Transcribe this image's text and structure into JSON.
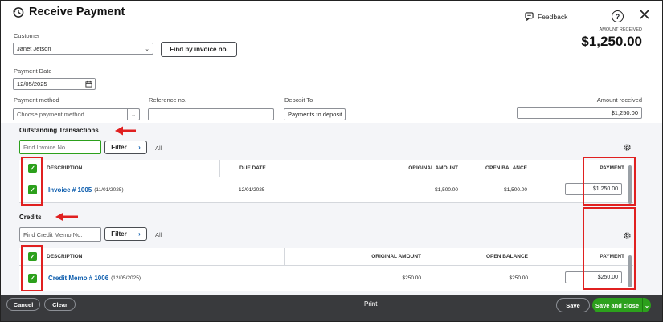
{
  "header": {
    "title": "Receive Payment",
    "feedback": "Feedback",
    "amount_received_label": "AMOUNT RECEIVED",
    "amount_received_value": "$1,250.00"
  },
  "form": {
    "customer_label": "Customer",
    "customer_value": "Janet Jetson",
    "find_invoice_button": "Find by invoice no.",
    "payment_date_label": "Payment Date",
    "payment_date_value": "12/05/2025",
    "payment_method_label": "Payment method",
    "payment_method_placeholder": "Choose payment method",
    "reference_label": "Reference no.",
    "deposit_to_label": "Deposit To",
    "deposit_to_value": "Payments to deposit",
    "amount_received_label": "Amount received",
    "amount_received_value": "$1,250.00"
  },
  "outstanding": {
    "title": "Outstanding Transactions",
    "search_placeholder": "Find Invoice No.",
    "filter_label": "Filter",
    "all_label": "All",
    "columns": [
      "DESCRIPTION",
      "DUE DATE",
      "ORIGINAL AMOUNT",
      "OPEN BALANCE",
      "PAYMENT"
    ],
    "rows": [
      {
        "description": "Invoice # 1005",
        "date": "(11/01/2025)",
        "due_date": "12/01/2025",
        "original_amount": "$1,500.00",
        "open_balance": "$1,500.00",
        "payment": "$1,250.00"
      }
    ]
  },
  "credits": {
    "title": "Credits",
    "search_placeholder": "Find Credit Memo No.",
    "filter_label": "Filter",
    "all_label": "All",
    "columns": [
      "DESCRIPTION",
      "ORIGINAL AMOUNT",
      "OPEN BALANCE",
      "PAYMENT"
    ],
    "rows": [
      {
        "description": "Credit Memo # 1006",
        "date": "(12/05/2025)",
        "original_amount": "$250.00",
        "open_balance": "$250.00",
        "payment": "$250.00"
      }
    ]
  },
  "footer": {
    "cancel": "Cancel",
    "clear": "Clear",
    "print": "Print",
    "save": "Save",
    "save_and_close": "Save and close"
  },
  "colors": {
    "accent_green": "#2ca01c",
    "link_blue": "#0b5cad",
    "annotation_red": "#e02020",
    "footer_bg": "#393a3d"
  }
}
